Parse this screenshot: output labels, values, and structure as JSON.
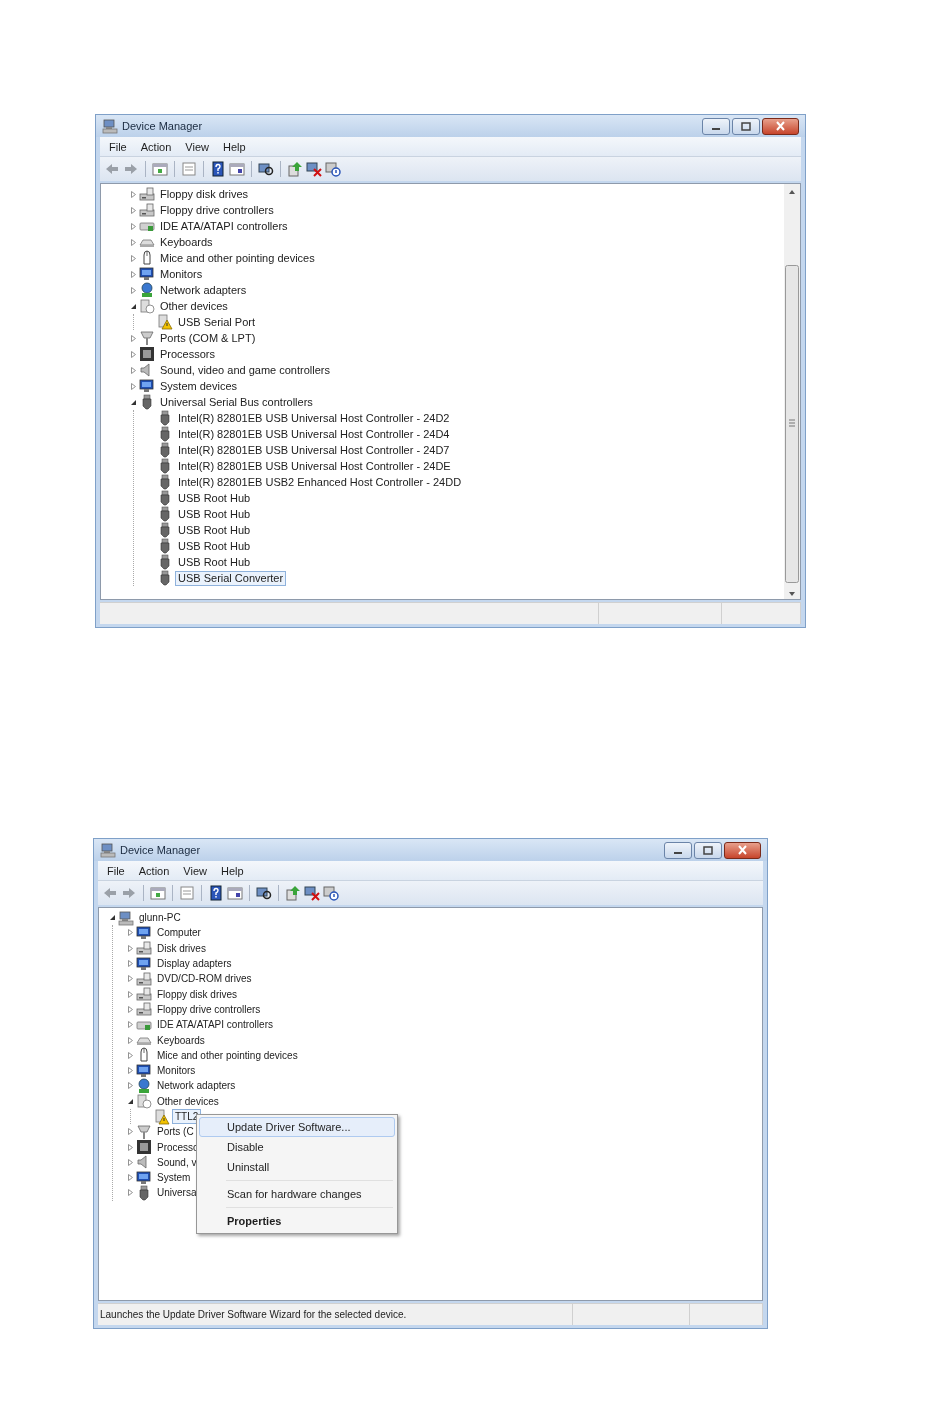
{
  "windows": [
    {
      "title": "Device Manager",
      "menu": [
        "File",
        "Action",
        "View",
        "Help"
      ],
      "tree": [
        {
          "label": "Floppy disk drives",
          "kind": "drive",
          "expanded": false,
          "selected": false
        },
        {
          "label": "Floppy drive controllers",
          "kind": "drive",
          "expanded": false,
          "selected": false
        },
        {
          "label": "IDE ATA/ATAPI controllers",
          "kind": "controller",
          "expanded": false,
          "selected": false
        },
        {
          "label": "Keyboards",
          "kind": "keyboard",
          "expanded": false,
          "selected": false
        },
        {
          "label": "Mice and other pointing devices",
          "kind": "mouse",
          "expanded": false,
          "selected": false
        },
        {
          "label": "Monitors",
          "kind": "monitor",
          "expanded": false,
          "selected": false
        },
        {
          "label": "Network adapters",
          "kind": "network",
          "expanded": false,
          "selected": false
        },
        {
          "label": "Other devices",
          "kind": "unknown",
          "expanded": true,
          "selected": false,
          "children": [
            {
              "label": "USB Serial Port",
              "kind": "warning",
              "selected": false
            }
          ]
        },
        {
          "label": "Ports (COM & LPT)",
          "kind": "port",
          "expanded": false,
          "selected": false
        },
        {
          "label": "Processors",
          "kind": "chip",
          "expanded": false,
          "selected": false
        },
        {
          "label": "Sound, video and game controllers",
          "kind": "speaker",
          "expanded": false,
          "selected": false
        },
        {
          "label": "System devices",
          "kind": "monitor",
          "expanded": false,
          "selected": false
        },
        {
          "label": "Universal Serial Bus controllers",
          "kind": "usb",
          "expanded": true,
          "selected": false,
          "children": [
            {
              "label": "Intel(R) 82801EB USB Universal Host Controller - 24D2",
              "kind": "usb",
              "selected": false
            },
            {
              "label": "Intel(R) 82801EB USB Universal Host Controller - 24D4",
              "kind": "usb",
              "selected": false
            },
            {
              "label": "Intel(R) 82801EB USB Universal Host Controller - 24D7",
              "kind": "usb",
              "selected": false
            },
            {
              "label": "Intel(R) 82801EB USB Universal Host Controller - 24DE",
              "kind": "usb",
              "selected": false
            },
            {
              "label": "Intel(R) 82801EB USB2 Enhanced Host Controller - 24DD",
              "kind": "usb",
              "selected": false
            },
            {
              "label": "USB Root Hub",
              "kind": "usb",
              "selected": false
            },
            {
              "label": "USB Root Hub",
              "kind": "usb",
              "selected": false
            },
            {
              "label": "USB Root Hub",
              "kind": "usb",
              "selected": false
            },
            {
              "label": "USB Root Hub",
              "kind": "usb",
              "selected": false
            },
            {
              "label": "USB Root Hub",
              "kind": "usb",
              "selected": false
            },
            {
              "label": "USB Serial Converter",
              "kind": "usb",
              "selected": true
            }
          ]
        }
      ]
    },
    {
      "title": "Device Manager",
      "menu": [
        "File",
        "Action",
        "View",
        "Help"
      ],
      "tree": [
        {
          "label": "glunn-PC",
          "kind": "computer",
          "expanded": true,
          "selected": false,
          "children": [
            {
              "label": "Computer",
              "kind": "monitor",
              "expanded": false,
              "selected": false
            },
            {
              "label": "Disk drives",
              "kind": "drive",
              "expanded": false,
              "selected": false
            },
            {
              "label": "Display adapters",
              "kind": "monitor",
              "expanded": false,
              "selected": false
            },
            {
              "label": "DVD/CD-ROM drives",
              "kind": "drive",
              "expanded": false,
              "selected": false
            },
            {
              "label": "Floppy disk drives",
              "kind": "drive",
              "expanded": false,
              "selected": false
            },
            {
              "label": "Floppy drive controllers",
              "kind": "drive",
              "expanded": false,
              "selected": false
            },
            {
              "label": "IDE ATA/ATAPI controllers",
              "kind": "controller",
              "expanded": false,
              "selected": false
            },
            {
              "label": "Keyboards",
              "kind": "keyboard",
              "expanded": false,
              "selected": false
            },
            {
              "label": "Mice and other pointing devices",
              "kind": "mouse",
              "expanded": false,
              "selected": false
            },
            {
              "label": "Monitors",
              "kind": "monitor",
              "expanded": false,
              "selected": false
            },
            {
              "label": "Network adapters",
              "kind": "network",
              "expanded": false,
              "selected": false
            },
            {
              "label": "Other devices",
              "kind": "unknown",
              "expanded": true,
              "selected": false,
              "children": [
                {
                  "label": "TTL2",
                  "kind": "warning",
                  "selected": true
                }
              ]
            },
            {
              "label": "Ports (C",
              "kind": "port",
              "expanded": false,
              "selected": false
            },
            {
              "label": "Processo",
              "kind": "chip",
              "expanded": false,
              "selected": false
            },
            {
              "label": "Sound, v",
              "kind": "speaker",
              "expanded": false,
              "selected": false
            },
            {
              "label": "System",
              "kind": "monitor",
              "expanded": false,
              "selected": false
            },
            {
              "label": "Universa",
              "kind": "usb",
              "expanded": false,
              "selected": false
            }
          ]
        }
      ],
      "context_menu": {
        "items": [
          {
            "label": "Update Driver Software...",
            "selected": true,
            "separator_before": false,
            "default": false
          },
          {
            "label": "Disable",
            "selected": false,
            "separator_before": false,
            "default": false
          },
          {
            "label": "Uninstall",
            "selected": false,
            "separator_before": false,
            "default": false
          },
          {
            "label": "Scan for hardware changes",
            "selected": false,
            "separator_before": true,
            "default": false
          },
          {
            "label": "Properties",
            "selected": false,
            "separator_before": true,
            "default": true
          }
        ]
      },
      "status_bar": {
        "text": "Launches the Update Driver Software Wizard for the selected device."
      }
    }
  ]
}
